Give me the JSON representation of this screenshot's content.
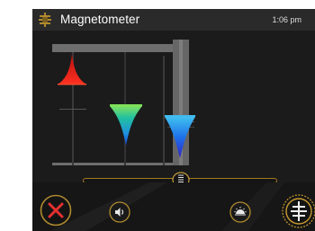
{
  "titlebar": {
    "title": "Magnetometer",
    "time": "1:06 pm",
    "app_icon": "magnet-icon"
  },
  "readings": [
    {
      "axis": "x",
      "color": "#e0201a",
      "direction": "up"
    },
    {
      "axis": "y",
      "color": "#2fb84a",
      "direction": "down"
    },
    {
      "axis": "z",
      "color": "#1a72e6",
      "direction": "down"
    }
  ],
  "slider": {
    "icon": "spring-icon"
  },
  "toolbar": {
    "close_icon": "close-x-icon",
    "sound_icon": "speaker-icon",
    "light_icon": "sunrise-icon",
    "mode_icon": "magnet-probe-icon"
  },
  "colors": {
    "accent_gold": "#b08a2e",
    "close_red": "#e53030",
    "background": "#1b1b1b"
  }
}
